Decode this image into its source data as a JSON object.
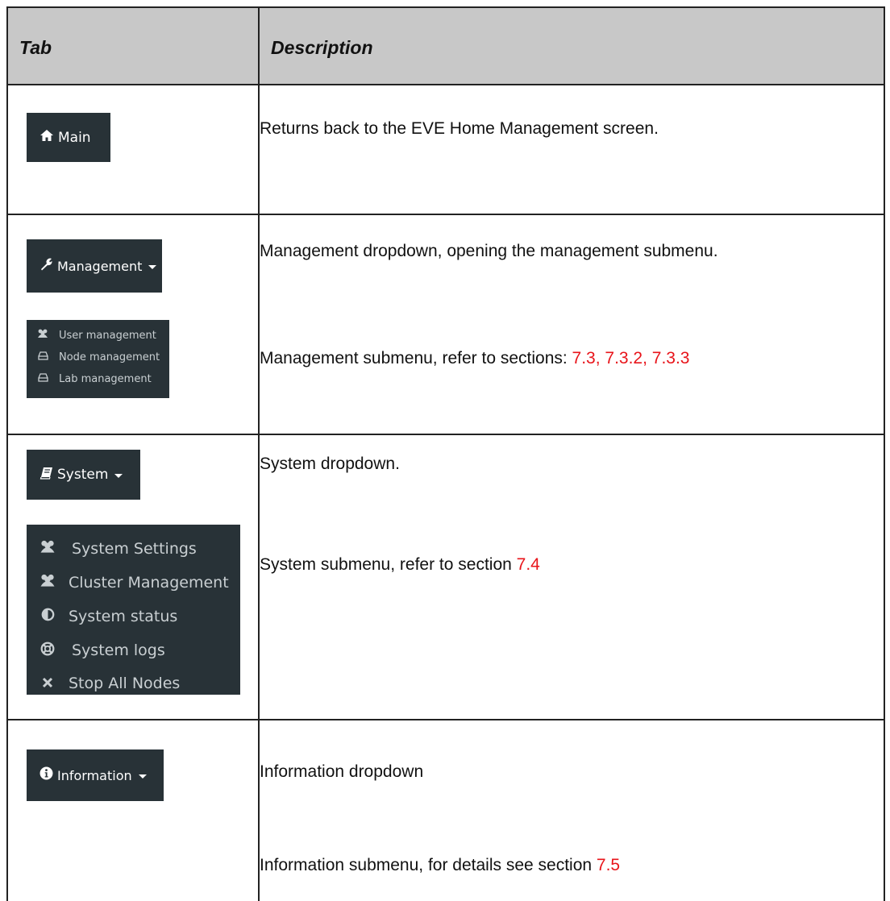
{
  "header": {
    "tab": "Tab",
    "description": "Description"
  },
  "rows": [
    {
      "button": {
        "label": "Main",
        "icon": "home-icon"
      },
      "desc1": "Returns back to the EVE Home Management screen."
    },
    {
      "button": {
        "label": "Management",
        "icon": "wrench-icon"
      },
      "submenu": [
        {
          "label": "User management",
          "icon": "users-icon"
        },
        {
          "label": "Node management",
          "icon": "hdd-icon"
        },
        {
          "label": "Lab management",
          "icon": "hdd-icon"
        }
      ],
      "desc1": "Management dropdown, opening the management submenu.",
      "desc2": "Management submenu, refer to sections: ",
      "desc2_ref": "7.3, 7.3.2, 7.3.3"
    },
    {
      "button": {
        "label": "System",
        "icon": "book-icon"
      },
      "submenu": [
        {
          "label": "System Settings",
          "icon": "users-icon"
        },
        {
          "label": "Cluster Management",
          "icon": "users-icon"
        },
        {
          "label": "System status",
          "icon": "adjust-icon"
        },
        {
          "label": "System logs",
          "icon": "life-ring-icon"
        },
        {
          "label": "Stop All Nodes",
          "icon": "close-icon"
        }
      ],
      "desc1": "System dropdown.",
      "desc2": "System submenu, refer to section ",
      "desc2_ref": "7.4"
    },
    {
      "button": {
        "label": "Information",
        "icon": "info-circle-icon"
      },
      "desc1": "Information dropdown",
      "desc2": "Information submenu, for details see section ",
      "desc2_ref": "7.5"
    }
  ],
  "colors": {
    "button_bg": "#283237",
    "reference": "#e8141a",
    "header_bg": "#c8c8c8"
  }
}
